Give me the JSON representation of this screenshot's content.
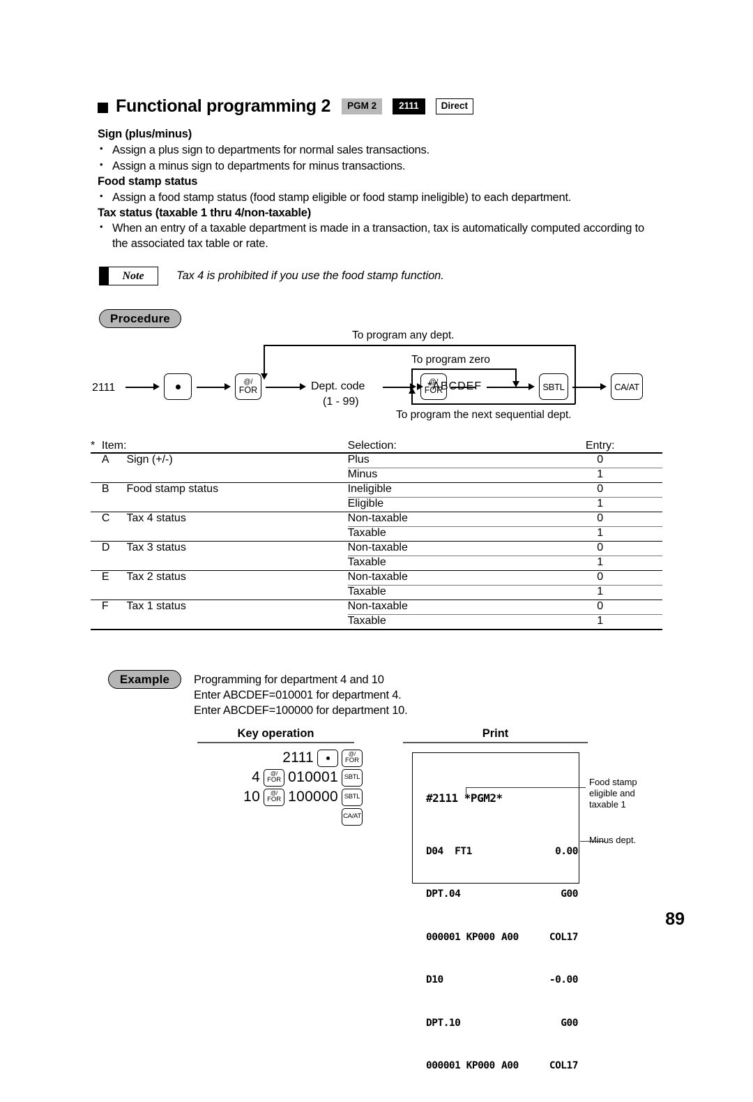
{
  "header": {
    "title": "Functional programming 2",
    "tags": [
      {
        "label": "PGM 2",
        "style": "grey"
      },
      {
        "label": "2111",
        "style": "black"
      },
      {
        "label": "Direct",
        "style": "outline"
      }
    ]
  },
  "sections": [
    {
      "heading": "Sign (plus/minus)",
      "bullets": [
        "Assign a plus sign to departments for normal sales transactions.",
        "Assign a minus sign to departments for minus transactions."
      ]
    },
    {
      "heading": "Food stamp status",
      "bullets": [
        "Assign a food stamp status (food stamp eligible or food stamp ineligible) to each department."
      ]
    },
    {
      "heading": "Tax status (taxable 1 thru 4/non-taxable)",
      "bullets": [
        "When an entry of a taxable department is made in a transaction, tax is automatically computed according to",
        "the associated tax table or rate."
      ]
    }
  ],
  "note": {
    "label": "Note",
    "text": "Tax 4 is prohibited if you use the food stamp function."
  },
  "procedure": {
    "pill": "Procedure",
    "start_code": "2111",
    "keys": {
      "dot": ".",
      "for_l1": "@/",
      "for_l2": "FOR",
      "sbtl": "SBTL",
      "caat": "CA/AT"
    },
    "dept_code": "Dept. code",
    "dept_range": "(1 - 99)",
    "abcdef": "*ABCDEF",
    "branch_any": "To program any dept.",
    "branch_zero": "To program zero",
    "branch_next": "To program the next sequential dept."
  },
  "table": {
    "star": "*",
    "headers": {
      "item": "Item:",
      "selection": "Selection:",
      "entry": "Entry:"
    },
    "rows": [
      {
        "letter": "A",
        "item": "Sign (+/-)",
        "options": [
          {
            "selection": "Plus",
            "entry": "0"
          },
          {
            "selection": "Minus",
            "entry": "1"
          }
        ]
      },
      {
        "letter": "B",
        "item": "Food stamp status",
        "options": [
          {
            "selection": "Ineligible",
            "entry": "0"
          },
          {
            "selection": "Eligible",
            "entry": "1"
          }
        ]
      },
      {
        "letter": "C",
        "item": "Tax 4 status",
        "options": [
          {
            "selection": "Non-taxable",
            "entry": "0"
          },
          {
            "selection": "Taxable",
            "entry": "1"
          }
        ]
      },
      {
        "letter": "D",
        "item": "Tax 3 status",
        "options": [
          {
            "selection": "Non-taxable",
            "entry": "0"
          },
          {
            "selection": "Taxable",
            "entry": "1"
          }
        ]
      },
      {
        "letter": "E",
        "item": "Tax 2 status",
        "options": [
          {
            "selection": "Non-taxable",
            "entry": "0"
          },
          {
            "selection": "Taxable",
            "entry": "1"
          }
        ]
      },
      {
        "letter": "F",
        "item": "Tax 1 status",
        "options": [
          {
            "selection": "Non-taxable",
            "entry": "0"
          },
          {
            "selection": "Taxable",
            "entry": "1"
          }
        ]
      }
    ]
  },
  "example": {
    "pill": "Example",
    "lines": [
      "Programming for department 4 and 10",
      "Enter ABCDEF=010001 for department 4.",
      "Enter ABCDEF=100000 for department 10."
    ],
    "key_operation_heading": "Key operation",
    "print_heading": "Print",
    "key_operation": [
      {
        "num": "2111",
        "keys": [
          "dot",
          "for"
        ]
      },
      {
        "num": "4",
        "key_after_num": "for",
        "num2": "010001",
        "keys": [
          "sbtl"
        ]
      },
      {
        "num": "10",
        "key_after_num": "for",
        "num2": "100000",
        "keys": [
          "sbtl"
        ]
      },
      {
        "num": "",
        "keys": [
          "caat"
        ]
      }
    ],
    "key_labels": {
      "dot": ".",
      "for_l1": "@/",
      "for_l2": "FOR",
      "sbtl": "SBTL",
      "caat": "CA/AT"
    }
  },
  "receipt": {
    "title": "#2111 *PGM2*",
    "lines": [
      {
        "left": "D04  FT1",
        "mid": "",
        "right": "0.00"
      },
      {
        "left": "DPT.04",
        "mid": "",
        "right": "G00"
      },
      {
        "left": "000001 KP000",
        "mid": "A00",
        "right": "COL17"
      },
      {
        "left": "D10",
        "mid": "",
        "right": "-0.00"
      },
      {
        "left": "DPT.10",
        "mid": "",
        "right": "G00"
      },
      {
        "left": "000001 KP000",
        "mid": "A00",
        "right": "COL17"
      }
    ]
  },
  "callouts": {
    "food_stamp": "Food stamp\neligible and\ntaxable 1",
    "minus_dept": "Minus dept."
  },
  "page_number": "89"
}
